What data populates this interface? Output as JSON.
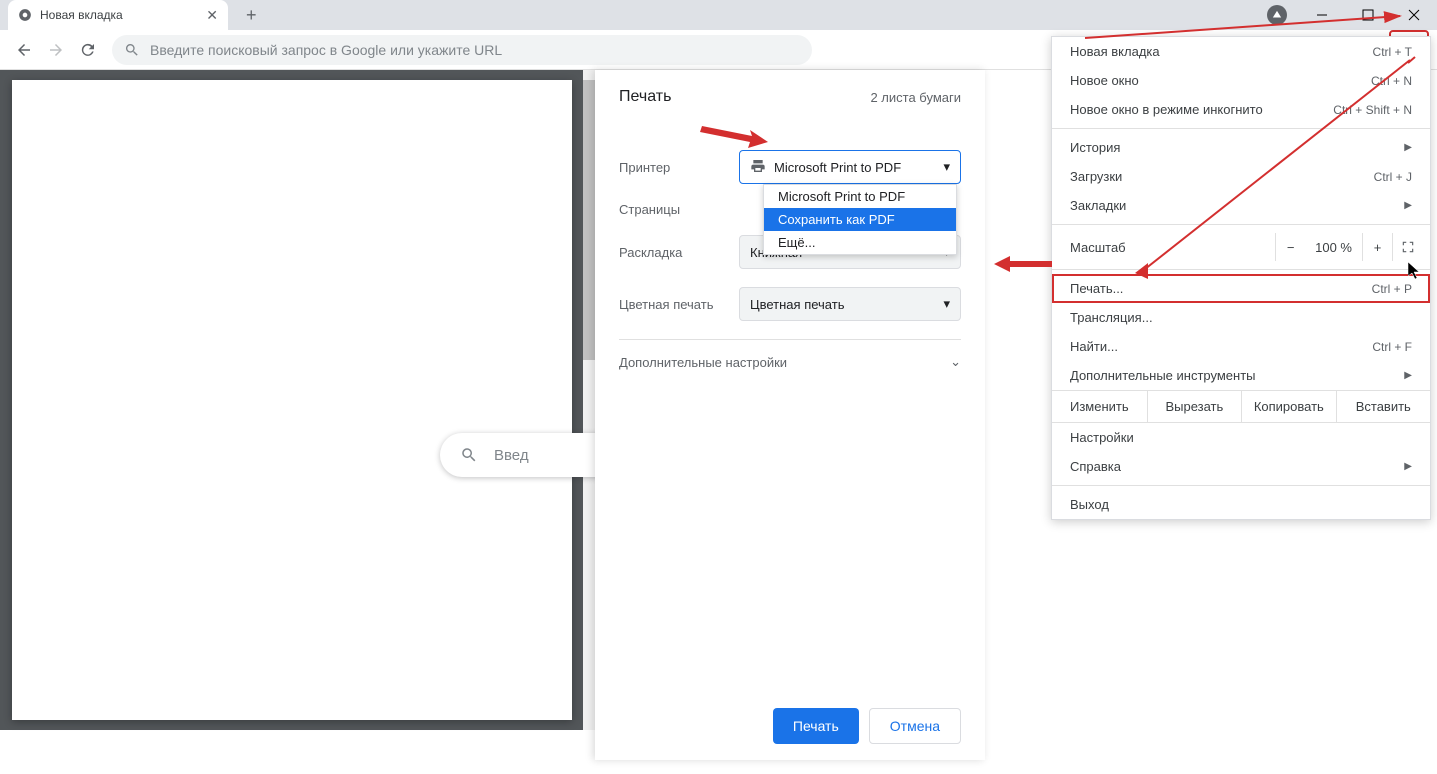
{
  "titlebar": {
    "tab_title": "Новая вкладка",
    "new_tab": "+"
  },
  "toolbar": {
    "omnibox_placeholder": "Введите поисковый запрос в Google или укажите URL"
  },
  "search_pill": {
    "placeholder_partial": "Введ"
  },
  "print": {
    "title": "Печать",
    "summary": "2 листа бумаги",
    "printer_label": "Принтер",
    "printer_value": "Microsoft Print to PDF",
    "dropdown": {
      "opt1": "Microsoft Print to PDF",
      "opt2": "Сохранить как PDF",
      "opt3": "Ещё..."
    },
    "pages_label": "Страницы",
    "layout_label": "Раскладка",
    "layout_value": "Книжная",
    "color_label": "Цветная печать",
    "color_value": "Цветная печать",
    "more_label": "Дополнительные настройки",
    "btn_print": "Печать",
    "btn_cancel": "Отмена"
  },
  "menu": {
    "new_tab": "Новая вкладка",
    "new_tab_sc": "Ctrl + T",
    "new_window": "Новое окно",
    "new_window_sc": "Ctrl + N",
    "incognito": "Новое окно в режиме инкогнито",
    "incognito_sc": "Ctrl + Shift + N",
    "history": "История",
    "downloads": "Загрузки",
    "downloads_sc": "Ctrl + J",
    "bookmarks": "Закладки",
    "zoom": "Масштаб",
    "zoom_value": "100 %",
    "print": "Печать...",
    "print_sc": "Ctrl + P",
    "cast": "Трансляция...",
    "find": "Найти...",
    "find_sc": "Ctrl + F",
    "tools": "Дополнительные инструменты",
    "edit_label": "Изменить",
    "cut": "Вырезать",
    "copy": "Копировать",
    "paste": "Вставить",
    "settings": "Настройки",
    "help": "Справка",
    "exit": "Выход"
  }
}
